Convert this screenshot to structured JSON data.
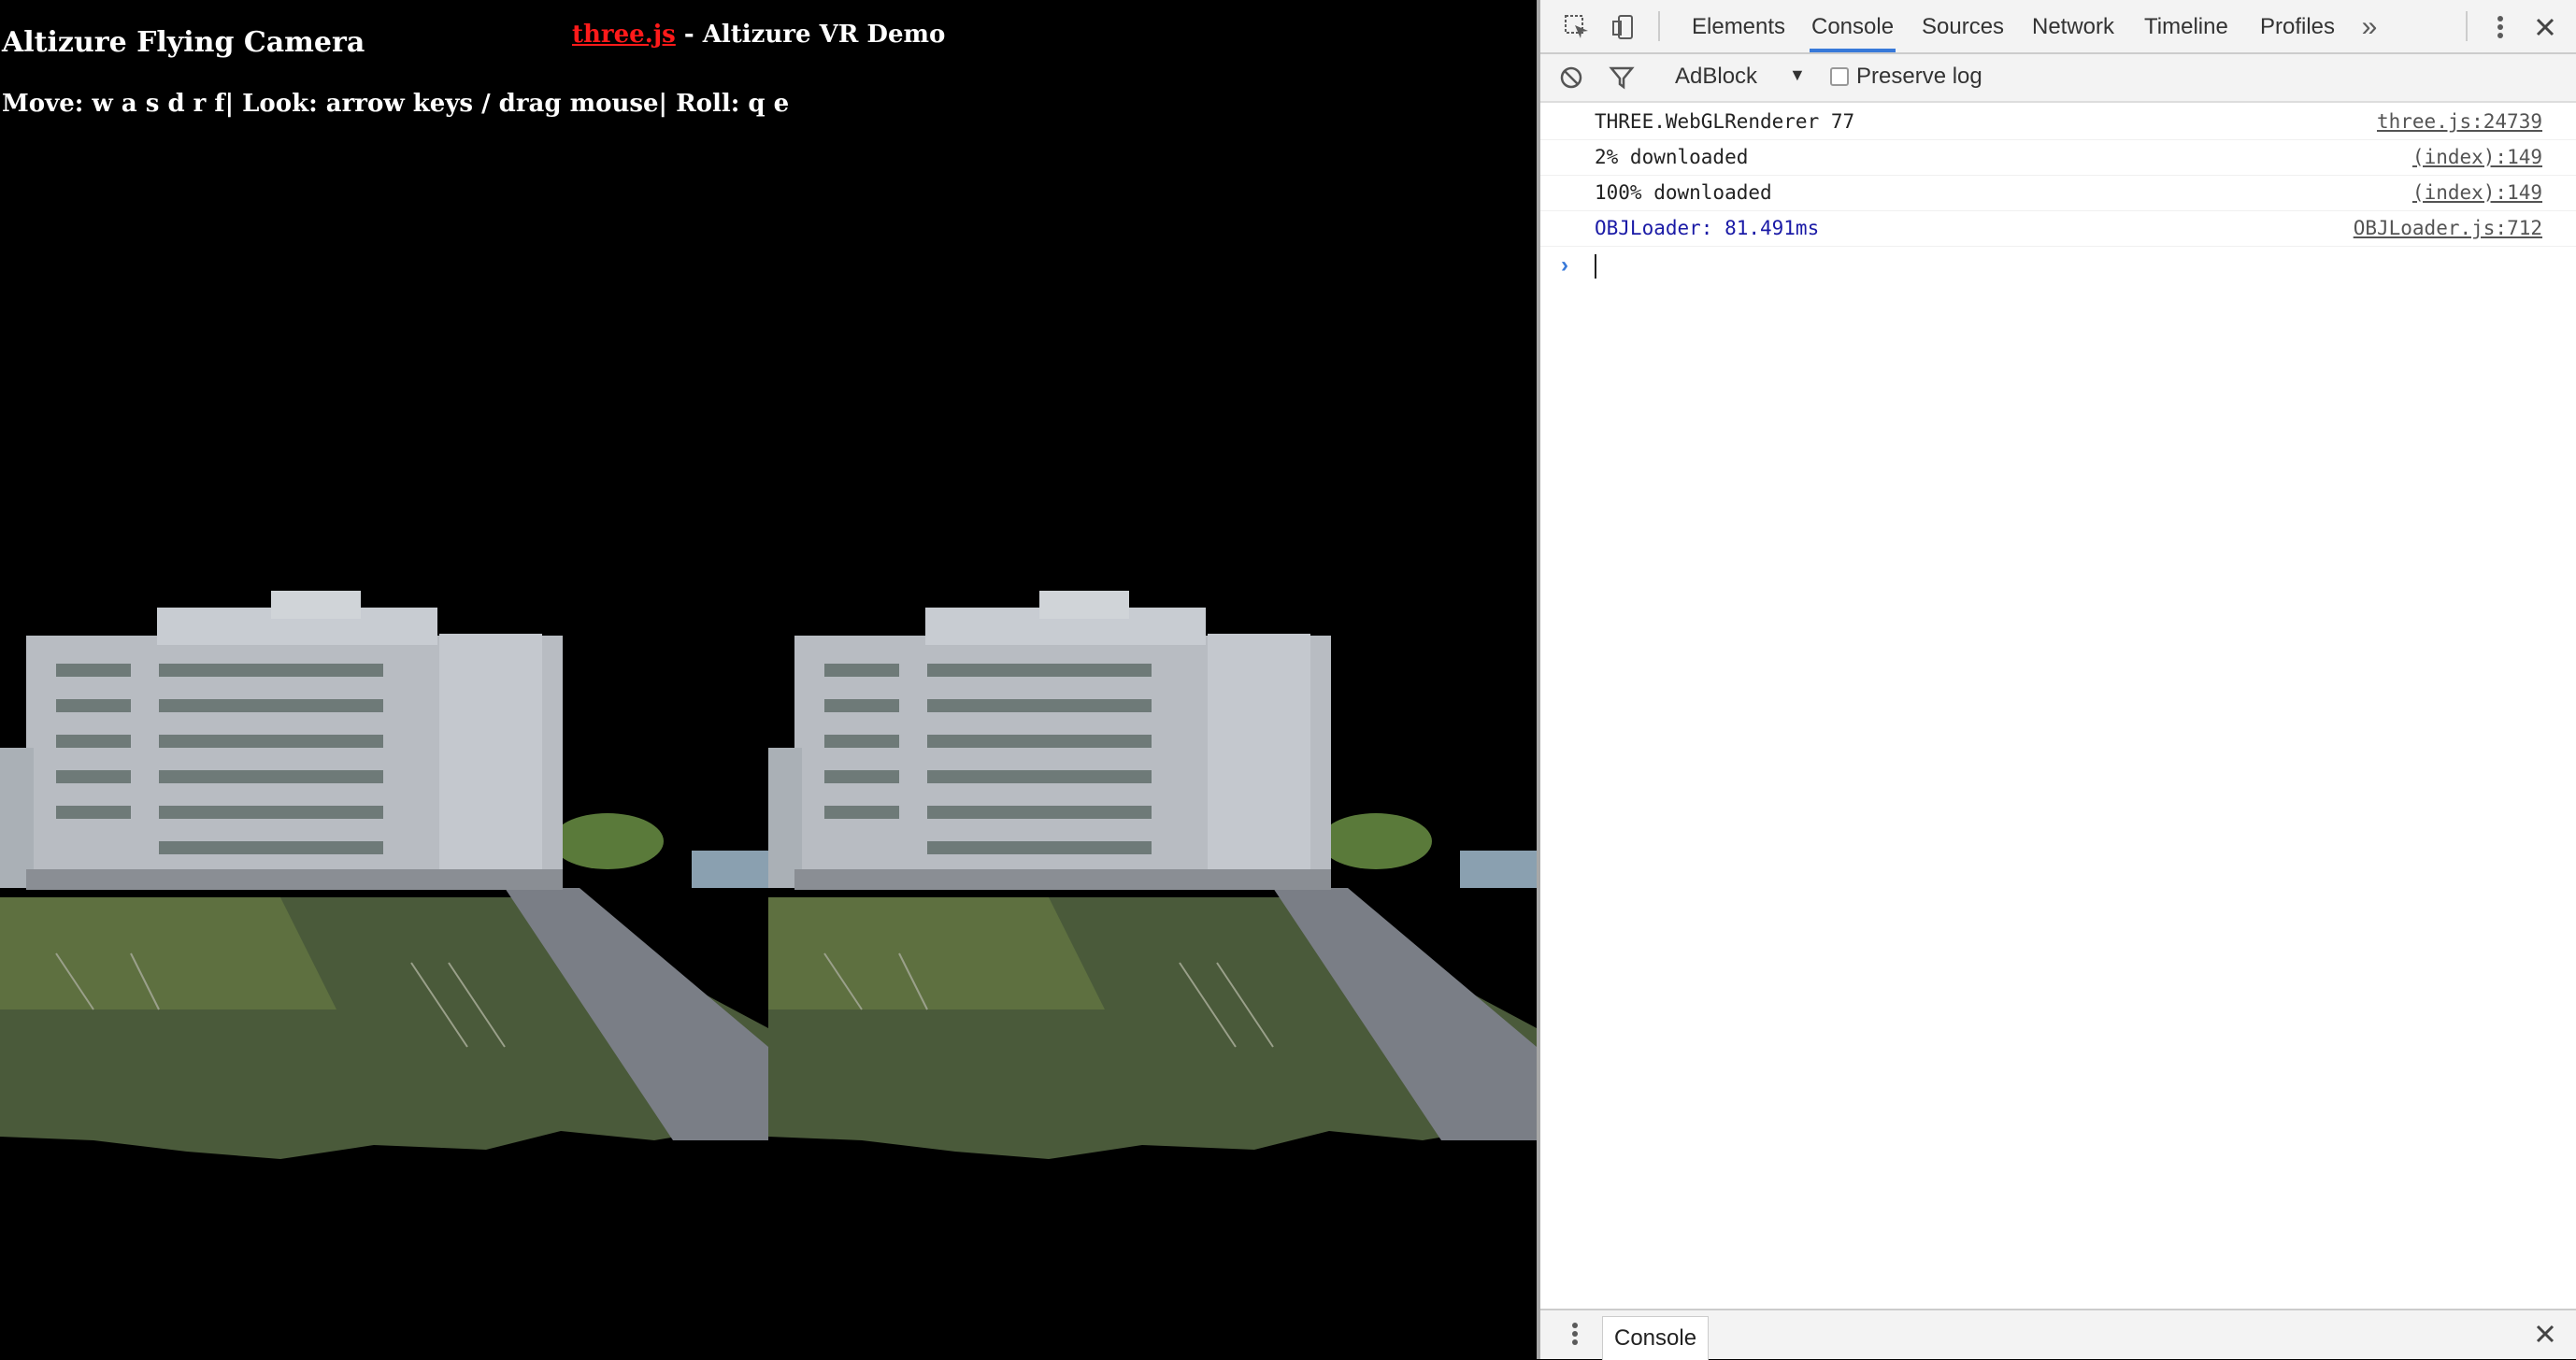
{
  "scene": {
    "title": "Altizure Flying Camera",
    "link_text": "three.js",
    "subtitle": " - Altizure VR Demo",
    "controls": "Move: w a s d r f| Look: arrow keys / drag mouse| Roll: q e"
  },
  "devtools": {
    "tabs": [
      "Elements",
      "Console",
      "Sources",
      "Network",
      "Timeline",
      "Profiles"
    ],
    "active_tab": "Console",
    "more_tabs_icon": "double-chevron-right-icon",
    "filter": {
      "context": "AdBlock",
      "preserve_log_label": "Preserve log",
      "preserve_log_checked": false
    },
    "console_messages": [
      {
        "text": "THREE.WebGLRenderer 77",
        "source": "three.js:24739",
        "color": "#222222"
      },
      {
        "text": "2% downloaded",
        "source": "(index):149",
        "color": "#222222"
      },
      {
        "text": "100% downloaded",
        "source": "(index):149",
        "color": "#222222"
      },
      {
        "text": "OBJLoader: 81.491ms",
        "source": "OBJLoader.js:712",
        "color": "#1a1aa6"
      }
    ],
    "drawer": {
      "tab_label": "Console"
    }
  },
  "colors": {
    "accent": "#3879d9",
    "link_red": "#ff1a1a",
    "background": "#000000"
  }
}
